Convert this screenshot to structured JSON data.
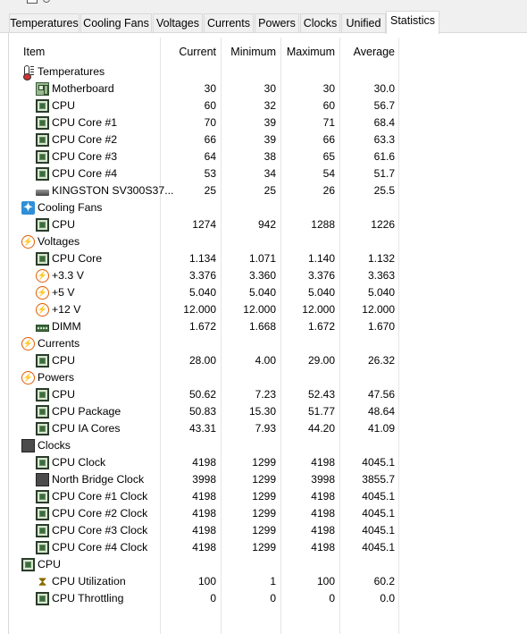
{
  "tabs": [
    {
      "label": "Temperatures",
      "active": false
    },
    {
      "label": "Cooling Fans",
      "active": false
    },
    {
      "label": "Voltages",
      "active": false
    },
    {
      "label": "Currents",
      "active": false
    },
    {
      "label": "Powers",
      "active": false
    },
    {
      "label": "Clocks",
      "active": false
    },
    {
      "label": "Unified",
      "active": false
    },
    {
      "label": "Statistics",
      "active": true
    }
  ],
  "columns": {
    "item": "Item",
    "current": "Current",
    "minimum": "Minimum",
    "maximum": "Maximum",
    "average": "Average"
  },
  "rows": [
    {
      "type": "group",
      "label": "Temperatures",
      "icon": "thermometer-icon"
    },
    {
      "type": "sensor",
      "label": "Motherboard",
      "icon": "motherboard-icon",
      "current": "30",
      "minimum": "30",
      "maximum": "30",
      "average": "30.0"
    },
    {
      "type": "sensor",
      "label": "CPU",
      "icon": "cpu-chip-icon",
      "current": "60",
      "minimum": "32",
      "maximum": "60",
      "average": "56.7"
    },
    {
      "type": "sensor",
      "label": "CPU Core #1",
      "icon": "cpu-chip-icon",
      "current": "70",
      "minimum": "39",
      "maximum": "71",
      "average": "68.4"
    },
    {
      "type": "sensor",
      "label": "CPU Core #2",
      "icon": "cpu-chip-icon",
      "current": "66",
      "minimum": "39",
      "maximum": "66",
      "average": "63.3"
    },
    {
      "type": "sensor",
      "label": "CPU Core #3",
      "icon": "cpu-chip-icon",
      "current": "64",
      "minimum": "38",
      "maximum": "65",
      "average": "61.6"
    },
    {
      "type": "sensor",
      "label": "CPU Core #4",
      "icon": "cpu-chip-icon",
      "current": "53",
      "minimum": "34",
      "maximum": "54",
      "average": "51.7"
    },
    {
      "type": "sensor",
      "label": "KINGSTON SV300S37...",
      "icon": "disk-drive-icon",
      "current": "25",
      "minimum": "25",
      "maximum": "26",
      "average": "25.5"
    },
    {
      "type": "group",
      "label": "Cooling Fans",
      "icon": "fan-icon"
    },
    {
      "type": "sensor",
      "label": "CPU",
      "icon": "cpu-chip-icon",
      "current": "1274",
      "minimum": "942",
      "maximum": "1288",
      "average": "1226"
    },
    {
      "type": "group",
      "label": "Voltages",
      "icon": "lightning-icon"
    },
    {
      "type": "sensor",
      "label": "CPU Core",
      "icon": "cpu-chip-icon",
      "current": "1.134",
      "minimum": "1.071",
      "maximum": "1.140",
      "average": "1.132"
    },
    {
      "type": "sensor",
      "label": "+3.3 V",
      "icon": "lightning-icon",
      "current": "3.376",
      "minimum": "3.360",
      "maximum": "3.376",
      "average": "3.363"
    },
    {
      "type": "sensor",
      "label": "+5 V",
      "icon": "lightning-icon",
      "current": "5.040",
      "minimum": "5.040",
      "maximum": "5.040",
      "average": "5.040"
    },
    {
      "type": "sensor",
      "label": "+12 V",
      "icon": "lightning-icon",
      "current": "12.000",
      "minimum": "12.000",
      "maximum": "12.000",
      "average": "12.000"
    },
    {
      "type": "sensor",
      "label": "DIMM",
      "icon": "memory-module-icon",
      "current": "1.672",
      "minimum": "1.668",
      "maximum": "1.672",
      "average": "1.670"
    },
    {
      "type": "group",
      "label": "Currents",
      "icon": "lightning-icon"
    },
    {
      "type": "sensor",
      "label": "CPU",
      "icon": "cpu-chip-icon",
      "current": "28.00",
      "minimum": "4.00",
      "maximum": "29.00",
      "average": "26.32"
    },
    {
      "type": "group",
      "label": "Powers",
      "icon": "lightning-icon"
    },
    {
      "type": "sensor",
      "label": "CPU",
      "icon": "cpu-chip-icon",
      "current": "50.62",
      "minimum": "7.23",
      "maximum": "52.43",
      "average": "47.56"
    },
    {
      "type": "sensor",
      "label": "CPU Package",
      "icon": "cpu-chip-icon",
      "current": "50.83",
      "minimum": "15.30",
      "maximum": "51.77",
      "average": "48.64"
    },
    {
      "type": "sensor",
      "label": "CPU IA Cores",
      "icon": "cpu-chip-icon",
      "current": "43.31",
      "minimum": "7.93",
      "maximum": "44.20",
      "average": "41.09"
    },
    {
      "type": "group",
      "label": "Clocks",
      "icon": "clock-chip-icon"
    },
    {
      "type": "sensor",
      "label": "CPU Clock",
      "icon": "cpu-chip-icon",
      "current": "4198",
      "minimum": "1299",
      "maximum": "4198",
      "average": "4045.1"
    },
    {
      "type": "sensor",
      "label": "North Bridge Clock",
      "icon": "clock-chip-icon",
      "current": "3998",
      "minimum": "1299",
      "maximum": "3998",
      "average": "3855.7"
    },
    {
      "type": "sensor",
      "label": "CPU Core #1 Clock",
      "icon": "cpu-chip-icon",
      "current": "4198",
      "minimum": "1299",
      "maximum": "4198",
      "average": "4045.1"
    },
    {
      "type": "sensor",
      "label": "CPU Core #2 Clock",
      "icon": "cpu-chip-icon",
      "current": "4198",
      "minimum": "1299",
      "maximum": "4198",
      "average": "4045.1"
    },
    {
      "type": "sensor",
      "label": "CPU Core #3 Clock",
      "icon": "cpu-chip-icon",
      "current": "4198",
      "minimum": "1299",
      "maximum": "4198",
      "average": "4045.1"
    },
    {
      "type": "sensor",
      "label": "CPU Core #4 Clock",
      "icon": "cpu-chip-icon",
      "current": "4198",
      "minimum": "1299",
      "maximum": "4198",
      "average": "4045.1"
    },
    {
      "type": "group",
      "label": "CPU",
      "icon": "cpu-chip-icon"
    },
    {
      "type": "sensor",
      "label": "CPU Utilization",
      "icon": "hourglass-icon",
      "current": "100",
      "minimum": "1",
      "maximum": "100",
      "average": "60.2"
    },
    {
      "type": "sensor",
      "label": "CPU Throttling",
      "icon": "cpu-chip-icon",
      "current": "0",
      "minimum": "0",
      "maximum": "0",
      "average": "0.0"
    }
  ]
}
